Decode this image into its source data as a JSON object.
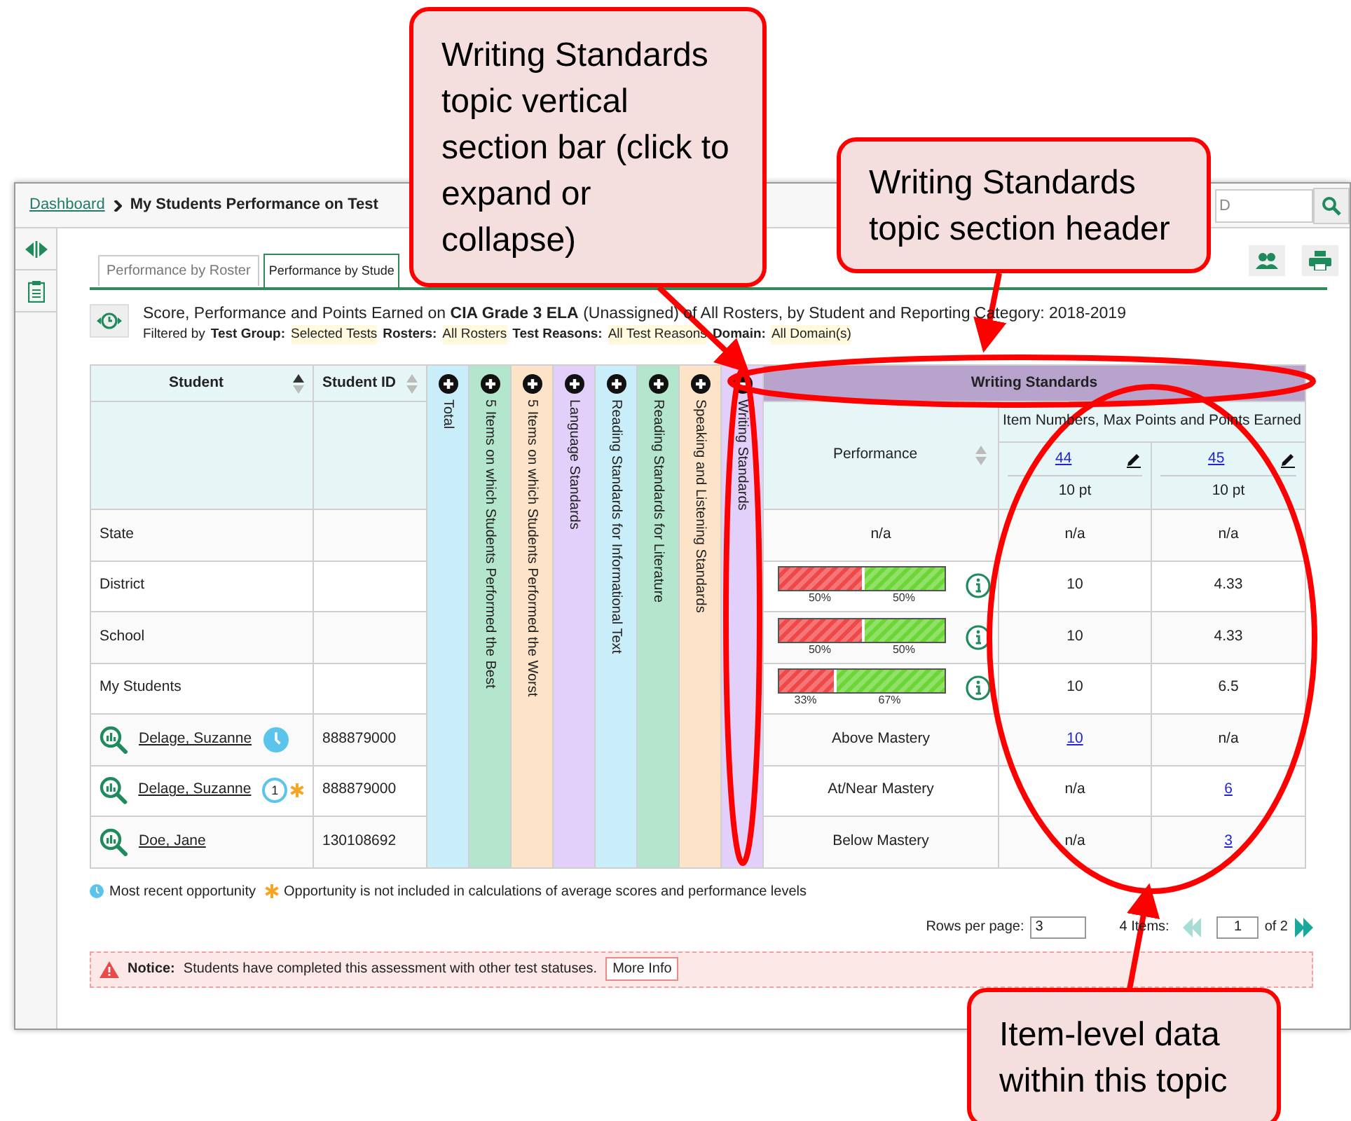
{
  "breadcrumb": {
    "link": "Dashboard",
    "current": "My Students Performance on Test"
  },
  "search": {
    "placeholder": "D"
  },
  "tabs": [
    {
      "label": "Performance by Roster",
      "selected": false
    },
    {
      "label": "Performance by Stude",
      "selected": true
    }
  ],
  "report": {
    "title": "Score, Performance and Points Earned on **CIA Grade 3 ELA** (Unassigned) of All Rosters, by Student and Reporting Category: 2018-2019",
    "filter_prefix": "Filtered by",
    "filters": [
      {
        "label": "Test Group:",
        "value": "Selected Tests"
      },
      {
        "label": "Rosters:",
        "value": "All Rosters"
      },
      {
        "label": "Test Reasons:",
        "value": "All Test Reasons"
      },
      {
        "label": "Domain:",
        "value": "All Domain(s)"
      }
    ]
  },
  "table": {
    "columns": [
      {
        "label": "Student",
        "sorted": true
      },
      {
        "label": "Student ID",
        "sorted": false
      }
    ],
    "topics": [
      {
        "label": "Total",
        "color": "#c9eefa",
        "expanded": false
      },
      {
        "label": "5 Items on which Students Performed the Best",
        "color": "#b4e6cd",
        "expanded": false
      },
      {
        "label": "5 Items on which Students Performed the Worst",
        "color": "#fde3c8",
        "expanded": false
      },
      {
        "label": "Language Standards",
        "color": "#e3d0fa",
        "expanded": false
      },
      {
        "label": "Reading Standards for Informational Text",
        "color": "#c9eefa",
        "expanded": false
      },
      {
        "label": "Reading Standards for Literature",
        "color": "#b4e6cd",
        "expanded": false
      },
      {
        "label": "Speaking and Listening Standards",
        "color": "#fde3c8",
        "expanded": false
      },
      {
        "label": "Writing Standards",
        "color": "#e3d0fa",
        "expanded": true
      }
    ],
    "section_header": "Writing Standards",
    "performance_header": "Performance",
    "items_header": "Item Numbers, Max Points and Points Earned",
    "items": [
      {
        "number": "44",
        "points": "10 pt"
      },
      {
        "number": "45",
        "points": "10 pt"
      }
    ],
    "rows": [
      {
        "kind": "aggregate",
        "name": "State",
        "performance": {
          "kind": "text",
          "text": "n/a"
        },
        "items": [
          {
            "text": "n/a",
            "link": false
          },
          {
            "text": "n/a",
            "link": false
          }
        ]
      },
      {
        "kind": "aggregate",
        "name": "District",
        "performance": {
          "kind": "bar",
          "segments": [
            {
              "level": 0.5,
              "label": "50%",
              "color": "#f04848"
            },
            {
              "level": 0.5,
              "label": "50%",
              "color": "#6cd636"
            }
          ]
        },
        "items": [
          {
            "text": "10",
            "link": false
          },
          {
            "text": "4.33",
            "link": false
          }
        ]
      },
      {
        "kind": "aggregate",
        "name": "School",
        "performance": {
          "kind": "bar",
          "segments": [
            {
              "level": 0.5,
              "label": "50%",
              "color": "#f04848"
            },
            {
              "level": 0.5,
              "label": "50%",
              "color": "#6cd636"
            }
          ]
        },
        "items": [
          {
            "text": "10",
            "link": false
          },
          {
            "text": "4.33",
            "link": false
          }
        ]
      },
      {
        "kind": "aggregate",
        "name": "My Students",
        "performance": {
          "kind": "bar",
          "segments": [
            {
              "level": 0.33,
              "label": "33%",
              "color": "#f04848"
            },
            {
              "level": 0.67,
              "label": "67%",
              "color": "#6cd636"
            }
          ]
        },
        "items": [
          {
            "text": "10",
            "link": false
          },
          {
            "text": "6.5",
            "link": false
          }
        ]
      },
      {
        "kind": "student",
        "name": "Delage, Suzanne",
        "id": "888879000",
        "recent": true,
        "opportunity": "",
        "excluded": false,
        "performance": {
          "kind": "text",
          "text": "Above Mastery"
        },
        "items": [
          {
            "text": "10",
            "link": true
          },
          {
            "text": "n/a",
            "link": false
          }
        ]
      },
      {
        "kind": "student",
        "name": "Delage, Suzanne",
        "id": "888879000",
        "recent": false,
        "opportunity": "1",
        "excluded": true,
        "performance": {
          "kind": "text",
          "text": "At/Near Mastery"
        },
        "items": [
          {
            "text": "n/a",
            "link": false
          },
          {
            "text": "6",
            "link": true
          }
        ]
      },
      {
        "kind": "student",
        "name": "Doe, Jane",
        "id": "130108692",
        "recent": false,
        "opportunity": "",
        "excluded": false,
        "performance": {
          "kind": "text",
          "text": "Below Mastery"
        },
        "items": [
          {
            "text": "n/a",
            "link": false
          },
          {
            "text": "3",
            "link": true
          }
        ]
      }
    ]
  },
  "legend": [
    {
      "kind": "clock",
      "text": "Most recent opportunity"
    },
    {
      "kind": "asterisk",
      "text": "Opportunity is not included in calculations of average scores and performance levels"
    }
  ],
  "pagination": {
    "rows_label": "Rows per page:",
    "rows_value": "3",
    "items_label": "4 Items:",
    "page": "1",
    "of": "of 2"
  },
  "notice": {
    "label": "Notice:",
    "text": "Students have completed this assessment with other test statuses.",
    "button": "More Info"
  },
  "callouts": [
    {
      "text": "Writing Standards topic vertical section bar (click to expand or collapse)"
    },
    {
      "text": "Writing Standards topic section header"
    },
    {
      "text": "Item-level data within this topic"
    }
  ]
}
